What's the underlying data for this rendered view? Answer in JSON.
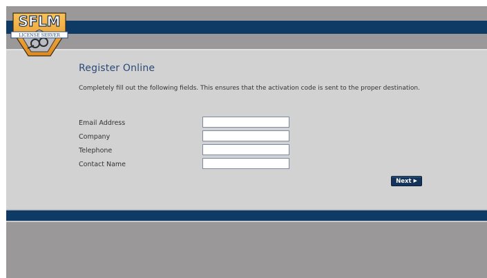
{
  "logo": {
    "name": "SFLM",
    "tagline": "LICENSE SERVER"
  },
  "page": {
    "title": "Register Online",
    "instructions": "Completely fill out the following fields. This ensures that the activation code is sent to the proper destination."
  },
  "form": {
    "fields": [
      {
        "label": "Email Address",
        "value": ""
      },
      {
        "label": "Company",
        "value": ""
      },
      {
        "label": "Telephone",
        "value": ""
      },
      {
        "label": "Contact Name",
        "value": ""
      }
    ],
    "next_label": "Next"
  },
  "icons": {
    "next": "play-arrow-icon",
    "logo": "key-emblem-icon"
  },
  "colors": {
    "navy": "#0d3b66",
    "panel": "#d2d2d2",
    "frame": "#9a9898",
    "logo_orange": "#f0a030"
  }
}
